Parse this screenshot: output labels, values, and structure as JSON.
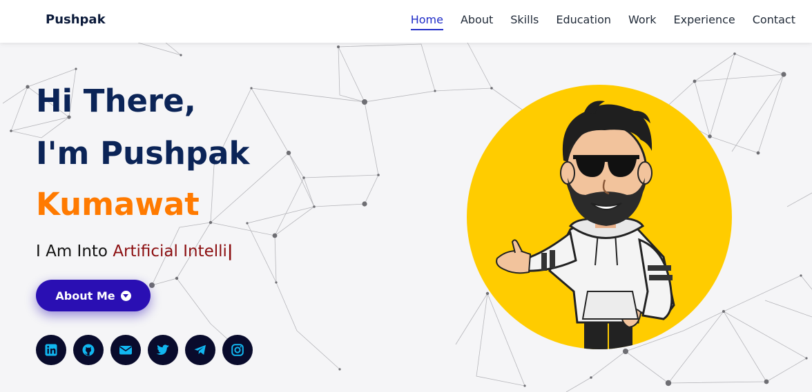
{
  "nav": {
    "brand": "Pushpak",
    "links": [
      {
        "label": "Home",
        "active": true
      },
      {
        "label": "About"
      },
      {
        "label": "Skills"
      },
      {
        "label": "Education"
      },
      {
        "label": "Work"
      },
      {
        "label": "Experience"
      },
      {
        "label": "Contact"
      }
    ]
  },
  "hero": {
    "line1": "Hi There,",
    "line2": "I'm Pushpak",
    "line3": "Kumawat",
    "tagline_prefix": "I Am Into ",
    "typed_text": "Artificial Intelli",
    "cursor": "|",
    "button_label": "About Me"
  },
  "socials": [
    {
      "name": "linkedin-icon"
    },
    {
      "name": "github-icon"
    },
    {
      "name": "envelope-icon"
    },
    {
      "name": "twitter-icon"
    },
    {
      "name": "telegram-icon"
    },
    {
      "name": "instagram-icon"
    }
  ],
  "colors": {
    "heading": "#0b2457",
    "accent_orange": "#ff7a00",
    "typed_red": "#8b0e10",
    "button": "#2a0fb3",
    "social_bg": "#090b2c",
    "social_icon": "#11b6f0",
    "avatar_bg": "#ffcc00"
  }
}
